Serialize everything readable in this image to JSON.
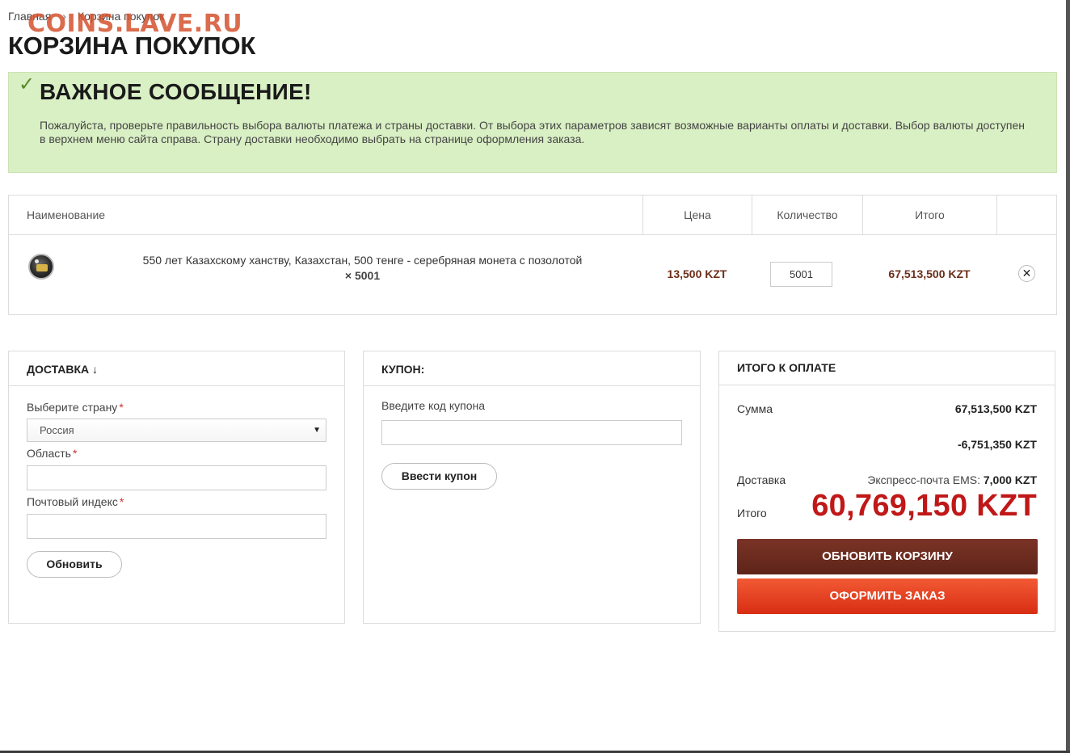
{
  "breadcrumb": {
    "home": "Главная",
    "separator": "›",
    "current": "Корзина покупок"
  },
  "watermark": "COINS.LAVE.RU",
  "page_title": "КОРЗИНА ПОКУПОК",
  "notice": {
    "icon": "check-icon",
    "title": "ВАЖНОЕ СООБЩЕНИЕ!",
    "text": "Пожалуйста, проверьте правильность выбора валюты платежа и страны доставки. От выбора этих параметров зависят возможные варианты оплаты и доставки. Выбор валюты доступен в верхнем меню сайта справа. Страну доставки необходимо выбрать на странице оформления заказа."
  },
  "cart": {
    "columns": {
      "name": "Наименование",
      "price": "Цена",
      "quantity": "Количество",
      "total": "Итого"
    },
    "items": [
      {
        "name": "550 лет Казахскому ханству, Казахстан, 500 тенге - серебряная монета с позолотой",
        "qty_label": "× 5001",
        "price": "13,500 KZT",
        "quantity": "5001",
        "total": "67,513,500 KZT",
        "remove_icon": "close-icon"
      }
    ]
  },
  "shipping": {
    "title": "ДОСТАВКА ↓",
    "country_label": "Выберите страну",
    "country_value": "Россия",
    "region_label": "Область",
    "region_value": "",
    "zip_label": "Почтовый индекс",
    "zip_value": "",
    "required_mark": "*",
    "update_button": "Обновить"
  },
  "coupon": {
    "title": "КУПОН:",
    "input_label": "Введите код купона",
    "input_value": "",
    "apply_button": "Ввести купон"
  },
  "summary": {
    "title": "ИТОГО К ОПЛАТЕ",
    "subtotal_label": "Сумма",
    "subtotal_value": "67,513,500 KZT",
    "discount_value": "-6,751,350 KZT",
    "delivery_label": "Доставка",
    "delivery_method": "Экспресс-почта EMS:",
    "delivery_value": "7,000 KZT",
    "total_label": "Итого",
    "total_value": "60,769,150 KZT",
    "update_cart_button": "ОБНОВИТЬ КОРЗИНУ",
    "checkout_button": "ОФОРМИТЬ ЗАКАЗ"
  },
  "colors": {
    "notice_bg": "#d9efc4",
    "price_color": "#6b2e1a",
    "grand_total_color": "#c01818",
    "update_button_bg": "#6b2a1f",
    "checkout_button_bg": "#e8401f"
  }
}
